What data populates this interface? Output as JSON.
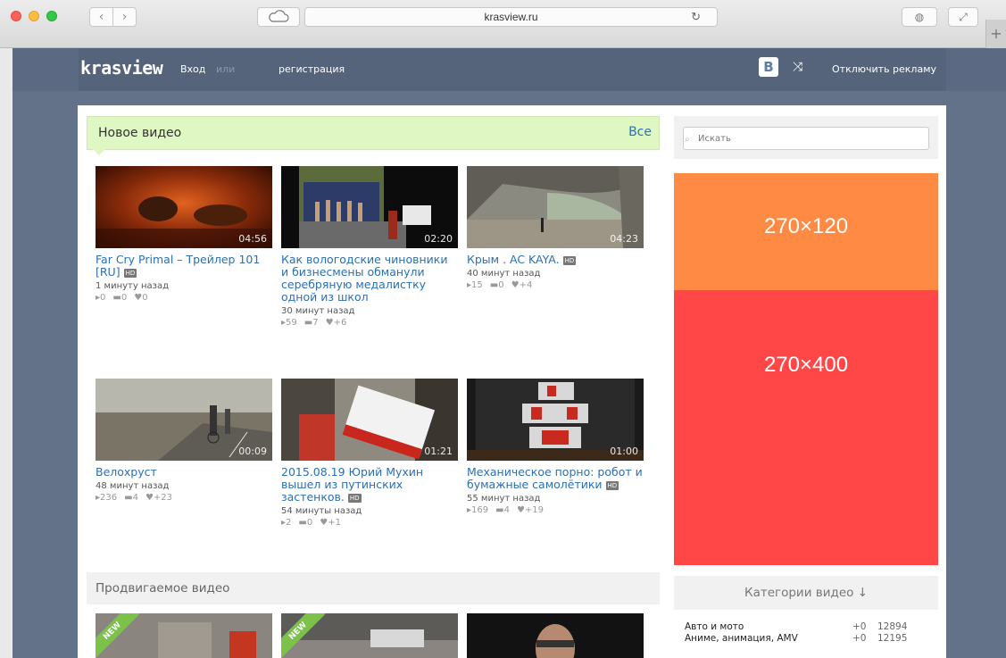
{
  "browser": {
    "url": "krasview.ru"
  },
  "header": {
    "logo": "krasview",
    "login": "Вход",
    "or": "или",
    "register": "регистрация",
    "vk": "B",
    "no_ads": "Отключить рекламу"
  },
  "new_videos": {
    "title": "Новое видео",
    "all_link": "Все",
    "hd_label": "HD",
    "items": [
      {
        "title": "Far Cry Primal – Трейлер 101 [RU]",
        "hd": true,
        "duration": "04:56",
        "time": "1 минуту назад",
        "views": "0",
        "comments": "0",
        "likes": "0"
      },
      {
        "title": "Как вологодские чиновники и бизнесмены обманули серебряную медалистку одной из школ",
        "hd": false,
        "duration": "02:20",
        "time": "30 минут назад",
        "views": "59",
        "comments": "7",
        "likes": "+6"
      },
      {
        "title": "Крым . AC KAYA.",
        "hd": true,
        "duration": "04:23",
        "time": "40 минут назад",
        "views": "15",
        "comments": "0",
        "likes": "+4"
      },
      {
        "title": "Велохруст",
        "hd": false,
        "duration": "00:09",
        "time": "48 минут назад",
        "views": "236",
        "comments": "4",
        "likes": "+23"
      },
      {
        "title": "2015.08.19 Юрий Мухин вышел из путинских застенков.",
        "hd": true,
        "duration": "01:21",
        "time": "54 минуты назад",
        "views": "2",
        "comments": "0",
        "likes": "+1"
      },
      {
        "title": "Механическое порно: робот и бумажные самолётики",
        "hd": true,
        "duration": "01:00",
        "time": "55 минут назад",
        "views": "169",
        "comments": "4",
        "likes": "+19"
      }
    ]
  },
  "promo": {
    "title": "Продвигаемое видео",
    "new_label": "NEW"
  },
  "search": {
    "placeholder": "Искать"
  },
  "ads": {
    "orange": "270×120",
    "red": "270×400"
  },
  "categories": {
    "title": "Категории видео ↓",
    "items": [
      {
        "name": "Авто и мото",
        "delta": "+0",
        "count": "12894"
      },
      {
        "name": "Аниме, анимация, AMV",
        "delta": "+0",
        "count": "12195"
      }
    ]
  },
  "colors": {
    "site_bg": "#637189",
    "new_video_header": "#dff7c3",
    "link": "#2b6fb5",
    "ad_orange": "#ff8a43",
    "ad_red": "#ff4747"
  }
}
